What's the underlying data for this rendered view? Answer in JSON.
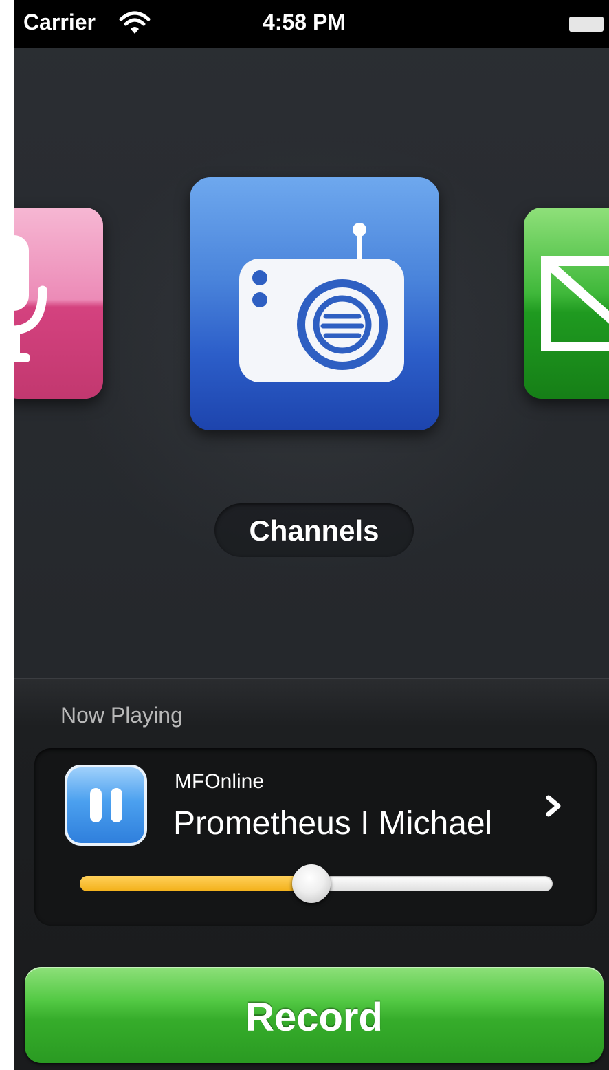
{
  "status_bar": {
    "carrier": "Carrier",
    "time": "4:58 PM",
    "wifi_icon": "wifi-icon",
    "battery_icon": "battery-icon"
  },
  "carousel": {
    "items": [
      {
        "name": "voice",
        "icon": "microphone-icon",
        "color": "#e16aa3"
      },
      {
        "name": "channels",
        "icon": "radio-icon",
        "color": "#3a6fd6"
      },
      {
        "name": "other",
        "icon": "picture-icon",
        "color": "#2ea82c"
      }
    ],
    "selected_label": "Channels"
  },
  "now_playing": {
    "title": "Now Playing",
    "station": "MFOnline",
    "track": "Prometheus I Michael",
    "progress": 0.49,
    "pause_icon": "pause-icon",
    "detail_icon": "chevron-right-icon",
    "accent_color": "#f5b521"
  },
  "record": {
    "label": "Record",
    "color": "#3fb534"
  }
}
